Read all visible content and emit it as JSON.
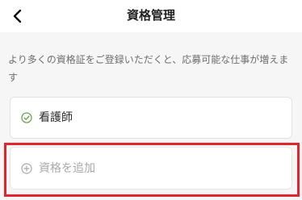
{
  "header": {
    "title": "資格管理",
    "back_icon": "chevron-left-icon"
  },
  "description": "より多くの資格証をご登録いただくと、応募可能な仕事が増えます",
  "qualifications": [
    {
      "label": "看護師",
      "icon": "check-circle-icon",
      "icon_color": "#6aa84f"
    }
  ],
  "add_button": {
    "label": "資格を追加",
    "icon": "plus-circle-icon"
  },
  "colors": {
    "highlight_border": "#e5252d",
    "background": "#f6f6f6"
  }
}
